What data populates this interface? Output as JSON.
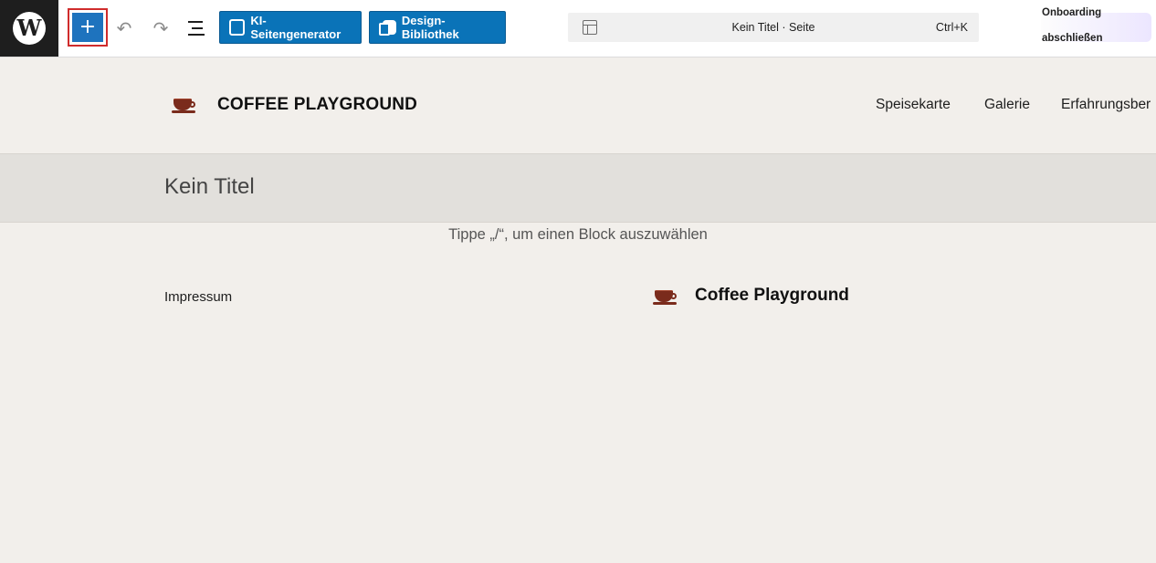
{
  "toolbar": {
    "logo_icon": "wordpress-logo-icon",
    "logo_glyph": "W",
    "add_block_icon": "plus-icon",
    "add_block_glyph": "+",
    "undo_icon": "undo-icon",
    "undo_glyph": "↶",
    "redo_icon": "redo-icon",
    "redo_glyph": "↷",
    "list_view_icon": "list-view-icon",
    "ai_generator_label": "KI-Seitengenerator",
    "design_library_label": "Design-Bibliothek",
    "document": {
      "title": "Kein Titel · Seite",
      "shortcut": "Ctrl+K"
    },
    "onboarding": {
      "line1": "Onboarding",
      "line2": "abschließen"
    }
  },
  "site": {
    "title": "COFFEE PLAYGROUND",
    "logo_icon": "coffee-cup-icon",
    "nav": [
      "Speisekarte",
      "Galerie",
      "Erfahrungsber"
    ]
  },
  "page": {
    "title": "Kein Titel",
    "block_prompt": "Tippe „/“, um einen Block auszuwählen"
  },
  "footer": {
    "link": "Impressum",
    "site_title": "Coffee Playground"
  },
  "colors": {
    "accent": "#0a73b8",
    "highlight": "#d02c2c",
    "canvas_bg": "#f2efeb",
    "title_band": "#e2e0dc",
    "coffee": "#7a2b1c"
  }
}
